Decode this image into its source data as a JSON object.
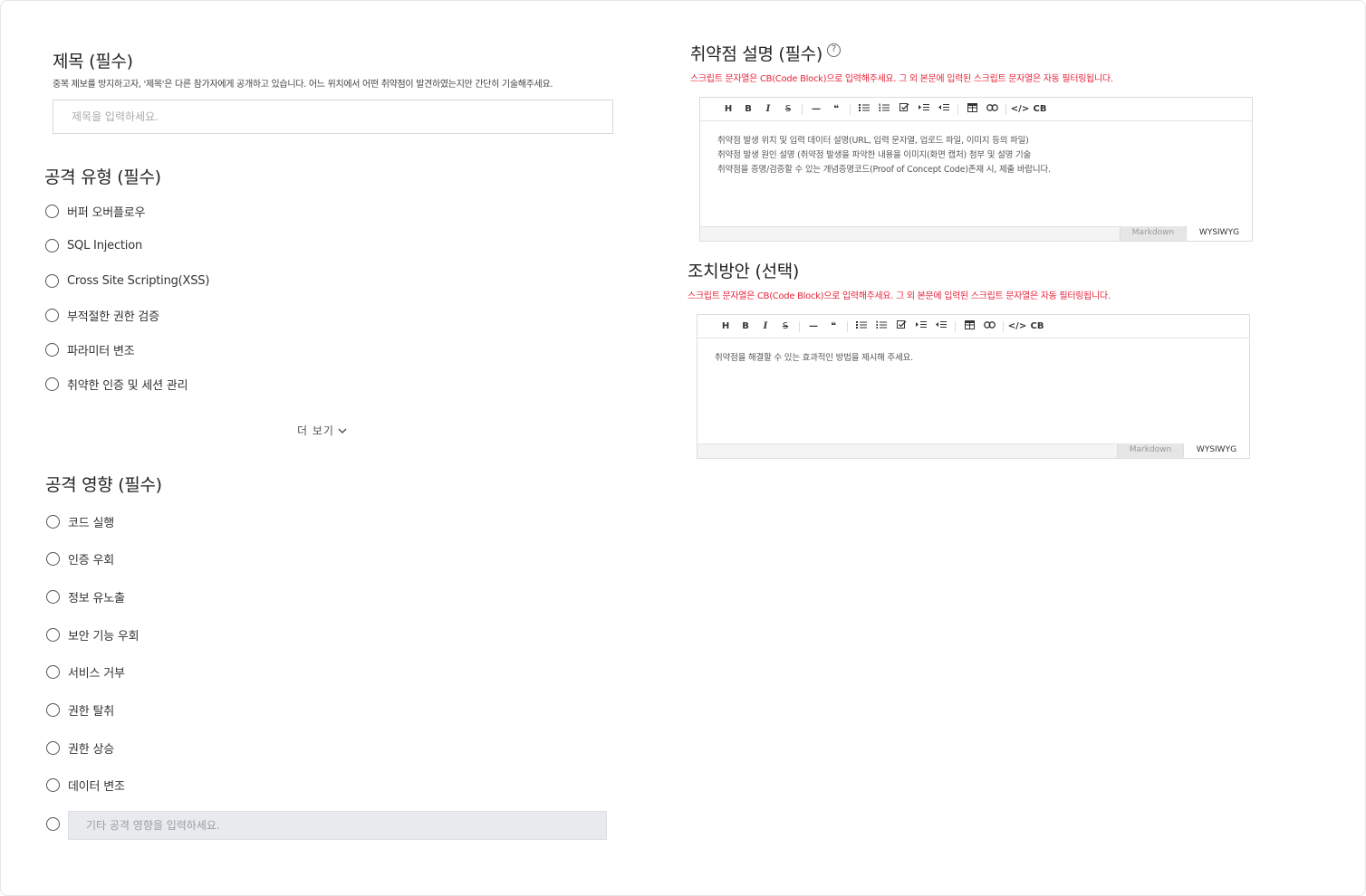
{
  "title_section": {
    "heading": "제목 (필수)",
    "description": "중복 제보를 방지하고자, '제목'은 다른 참가자에게 공개하고 있습니다. 어느 위치에서 어떤 취약점이 발견하였는지만 간단히 기술해주세요.",
    "placeholder": "제목을 입력하세요."
  },
  "attack_type": {
    "heading": "공격 유형 (필수)",
    "options": [
      "버퍼 오버플로우",
      "SQL Injection",
      "Cross Site Scripting(XSS)",
      "부적절한 권한 검증",
      "파라미터 변조",
      "취약한 인증 및 세션 관리"
    ],
    "more_label": "더 보기"
  },
  "attack_impact": {
    "heading": "공격 영향 (필수)",
    "options": [
      "코드 실행",
      "인증 우회",
      "정보 유노출",
      "보안 기능 우회",
      "서비스 거부",
      "권한 탈취",
      "권한 상승",
      "데이터 변조"
    ],
    "other_placeholder": "기타 공격 영향을 입력하세요."
  },
  "vuln_desc": {
    "heading": "취약점 설명 (필수)",
    "help_icon": "question-circle-icon",
    "warning": "스크립트 문자열은 CB(Code Block)으로 입력해주세요. 그 외 본문에 입력된 스크립트 문자열은 자동 필터링됩니다.",
    "placeholder_lines": [
      "취약점 발생 위치 및 입력 데이터 설명(URL, 입력 문자열, 업로드 파일, 이미지 등의 파일)",
      "취약점 발생 원인 설명 (취약점 발생을 파악한 내용을 이미지(화면 캡처) 첨부 및 설명 기술",
      "취약점을 증명/검증할 수 있는 개념증명코드(Proof of Concept Code)존재 시, 제출 바랍니다."
    ]
  },
  "remediation": {
    "heading": "조치방안 (선택)",
    "warning": "스크립트 문자열은 CB(Code Block)으로 입력해주세요. 그 외 본문에 입력된 스크립트 문자열은 자동 필터링됩니다.",
    "placeholder_lines": [
      "취약점을 해결할 수 있는 효과적인 방법을 제시해 주세요."
    ]
  },
  "toolbar": {
    "heading": "H",
    "bold": "B",
    "italic": "I",
    "strike": "S",
    "hr": "—",
    "quote": "❝",
    "code": "</>",
    "codeblock": "CB"
  },
  "editor_modes": {
    "markdown": "Markdown",
    "wysiwyg": "WYSIWYG"
  },
  "colors": {
    "warning": "#e8243a",
    "border": "#dcdcdc"
  }
}
